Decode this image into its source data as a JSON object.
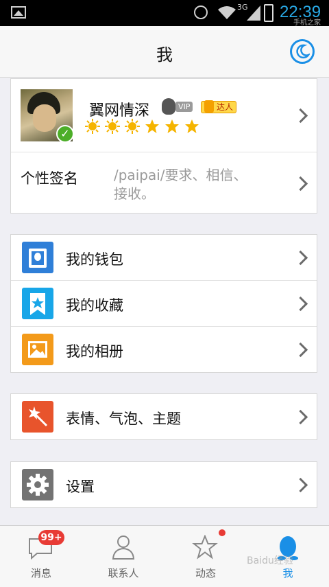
{
  "status_bar": {
    "network": "3G",
    "time": "22:39",
    "watermark": "手机之家"
  },
  "header": {
    "title": "我"
  },
  "profile": {
    "name": "翼网情深",
    "vip_label": "VIP",
    "badge_label": "达人",
    "star_count": 6
  },
  "signature": {
    "label": "个性签名",
    "value": "/paipai/要求、相信、接收。"
  },
  "menu_group1": [
    {
      "label": "我的钱包",
      "icon": "wallet-icon",
      "color": "#2f7fd8"
    },
    {
      "label": "我的收藏",
      "icon": "favorites-icon",
      "color": "#18a6e8"
    },
    {
      "label": "我的相册",
      "icon": "album-icon",
      "color": "#f39a1a"
    }
  ],
  "menu_group2": [
    {
      "label": "表情、气泡、主题",
      "icon": "magic-wand-icon",
      "color": "#e8542c"
    }
  ],
  "menu_group3": [
    {
      "label": "设置",
      "icon": "gear-icon",
      "color": "#737373"
    }
  ],
  "tabs": [
    {
      "label": "消息",
      "badge": "99+"
    },
    {
      "label": "联系人"
    },
    {
      "label": "动态"
    },
    {
      "label": "我"
    }
  ],
  "colors": {
    "accent": "#1a8fe6",
    "badge": "#e83b35"
  },
  "overlay_watermark": "Baidu经验"
}
